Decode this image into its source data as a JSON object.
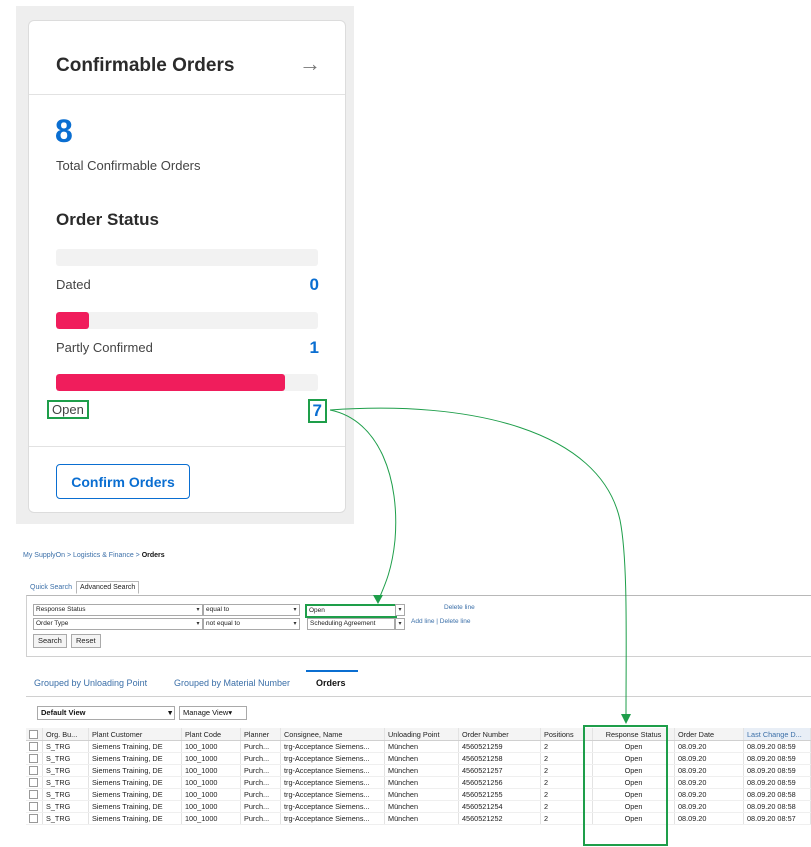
{
  "card": {
    "title": "Confirmable Orders",
    "arrow": "→",
    "total": "8",
    "total_label": "Total Confirmable Orders",
    "section_title": "Order Status",
    "statuses": [
      {
        "label": "Dated",
        "count": "0",
        "fraction": 0.0
      },
      {
        "label": "Partly Confirmed",
        "count": "1",
        "fraction": 0.125
      },
      {
        "label": "Open",
        "count": "7",
        "fraction": 0.875
      }
    ],
    "confirm_button": "Confirm Orders"
  },
  "orders_page": {
    "breadcrumb": {
      "part1": "My SupplyOn",
      "sep": " > ",
      "part2": "Logistics & Finance",
      "current": "Orders"
    },
    "search_tabs": [
      "Quick Search",
      "Advanced Search"
    ],
    "criteria": [
      {
        "field": "Response Status",
        "operator": "equal to",
        "value": "Open",
        "links": "Delete line"
      },
      {
        "field": "Order Type",
        "operator": "not equal to",
        "value": "Scheduling Agreement",
        "links": "Add line | Delete line"
      }
    ],
    "search_button": "Search",
    "reset_button": "Reset",
    "view_tabs": [
      "Grouped by Unloading Point",
      "Grouped by Material Number",
      "Orders"
    ],
    "view_select": "Default View",
    "manage_view": "Manage View",
    "columns": [
      "Org. Bu...",
      "Plant Customer",
      "Plant Code",
      "Planner",
      "Consignee, Name",
      "Unloading Point",
      "Order Number",
      "Positions",
      "Response Status",
      "Order Date",
      "Last Change D..."
    ],
    "rows": [
      [
        "S_TRG",
        "Siemens Training, DE",
        "100_1000",
        "Purch...",
        "trg-Acceptance Siemens...",
        "München",
        "4560521259",
        "2",
        "Open",
        "08.09.20",
        "08.09.20 08:59"
      ],
      [
        "S_TRG",
        "Siemens Training, DE",
        "100_1000",
        "Purch...",
        "trg-Acceptance Siemens...",
        "München",
        "4560521258",
        "2",
        "Open",
        "08.09.20",
        "08.09.20 08:59"
      ],
      [
        "S_TRG",
        "Siemens Training, DE",
        "100_1000",
        "Purch...",
        "trg-Acceptance Siemens...",
        "München",
        "4560521257",
        "2",
        "Open",
        "08.09.20",
        "08.09.20 08:59"
      ],
      [
        "S_TRG",
        "Siemens Training, DE",
        "100_1000",
        "Purch...",
        "trg-Acceptance Siemens...",
        "München",
        "4560521256",
        "2",
        "Open",
        "08.09.20",
        "08.09.20 08:59"
      ],
      [
        "S_TRG",
        "Siemens Training, DE",
        "100_1000",
        "Purch...",
        "trg-Acceptance Siemens...",
        "München",
        "4560521255",
        "2",
        "Open",
        "08.09.20",
        "08.09.20 08:58"
      ],
      [
        "S_TRG",
        "Siemens Training, DE",
        "100_1000",
        "Purch...",
        "trg-Acceptance Siemens...",
        "München",
        "4560521254",
        "2",
        "Open",
        "08.09.20",
        "08.09.20 08:58"
      ],
      [
        "S_TRG",
        "Siemens Training, DE",
        "100_1000",
        "Purch...",
        "trg-Acceptance Siemens...",
        "München",
        "4560521252",
        "2",
        "Open",
        "08.09.20",
        "08.09.20 08:57"
      ]
    ]
  },
  "colors": {
    "accent": "#0a6ed1",
    "bar": "#f01d5c",
    "highlight": "#1e9e4a"
  }
}
